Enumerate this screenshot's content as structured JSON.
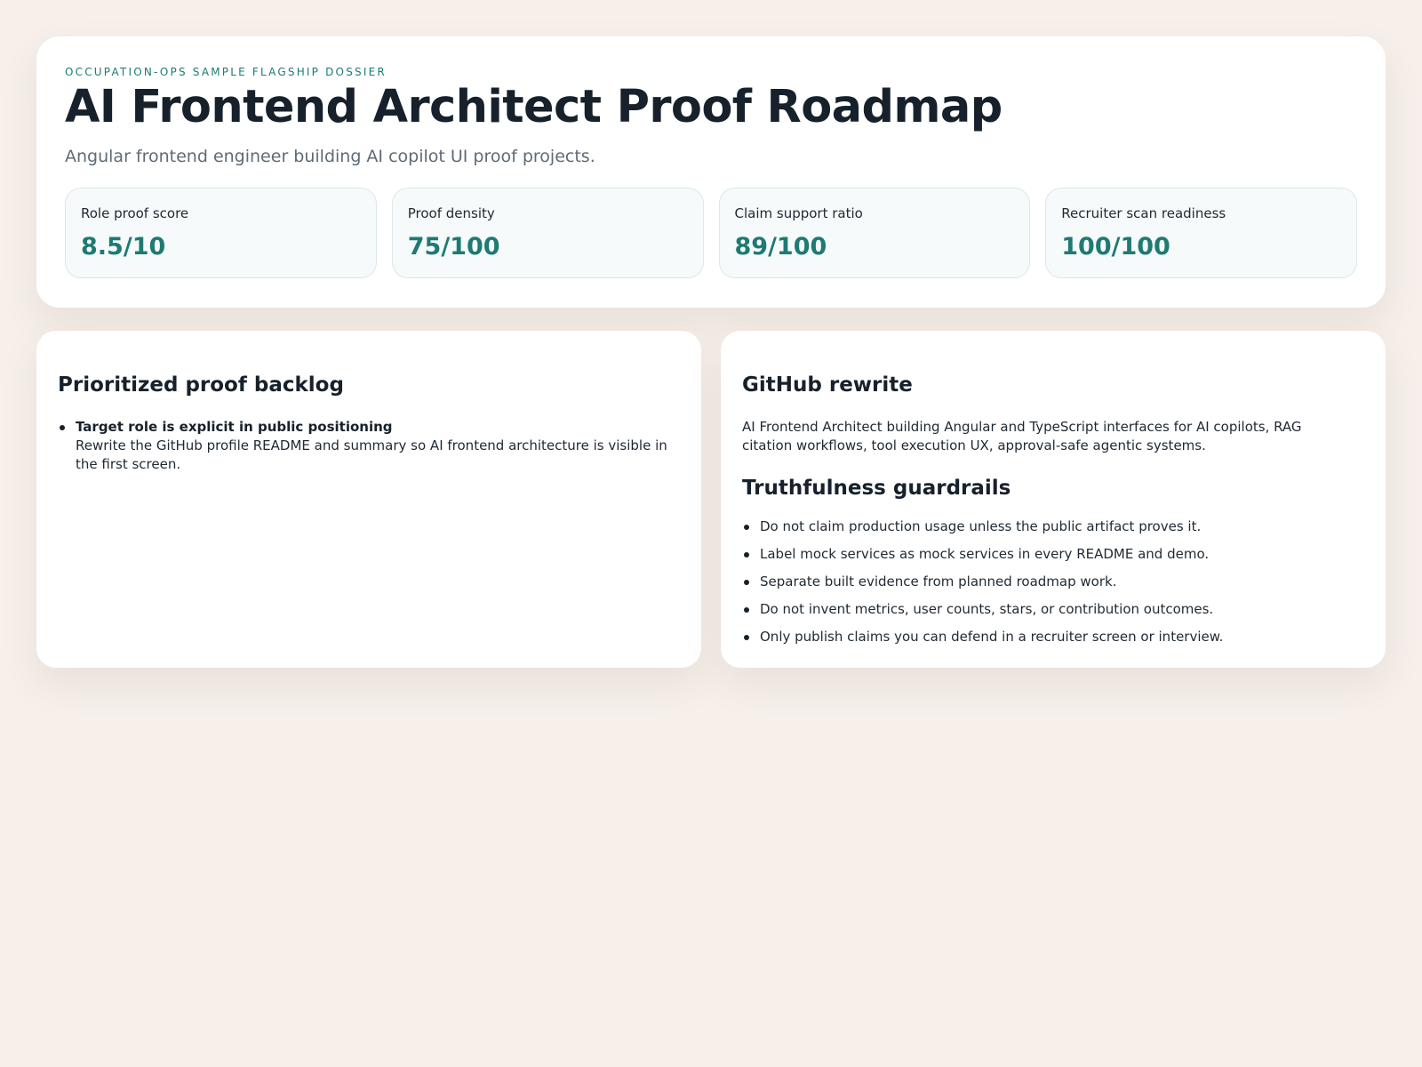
{
  "hero": {
    "eyebrow": "OCCUPATION-OPS SAMPLE FLAGSHIP DOSSIER",
    "title": "AI Frontend Architect Proof Roadmap",
    "subtitle": "Angular frontend engineer building AI copilot UI proof projects.",
    "metrics": [
      {
        "label": "Role proof score",
        "value": "8.5/10"
      },
      {
        "label": "Proof density",
        "value": "75/100"
      },
      {
        "label": "Claim support ratio",
        "value": "89/100"
      },
      {
        "label": "Recruiter scan readiness",
        "value": "100/100"
      }
    ]
  },
  "backlog": {
    "heading": "Prioritized proof backlog",
    "items": [
      {
        "title": "Target role is explicit in public positioning",
        "body": "Rewrite the GitHub profile README and summary so AI frontend architecture is visible in the first screen."
      }
    ]
  },
  "github": {
    "heading": "GitHub rewrite",
    "text": "AI Frontend Architect building Angular and TypeScript interfaces for AI copilots, RAG citation workflows, tool execution UX, approval-safe agentic systems."
  },
  "guardrails": {
    "heading": "Truthfulness guardrails",
    "items": [
      "Do not claim production usage unless the public artifact proves it.",
      "Label mock services as mock services in every README and demo.",
      "Separate built evidence from planned roadmap work.",
      "Do not invent metrics, user counts, stars, or contribution outcomes.",
      "Only publish claims you can defend in a recruiter screen or interview."
    ]
  },
  "colors": {
    "accent": "#1e7a72",
    "background": "#f6efea",
    "text": "#17212b"
  }
}
